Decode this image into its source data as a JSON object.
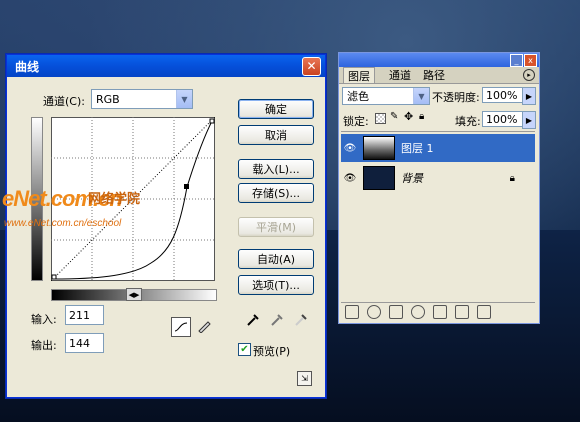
{
  "curves_dialog": {
    "title": "曲线",
    "channel_label": "通道(C):",
    "channel_value": "RGB",
    "ok_label": "确定",
    "cancel_label": "取消",
    "load_label": "载入(L)...",
    "save_label": "存储(S)...",
    "smooth_label": "平滑(M)",
    "auto_label": "自动(A)",
    "options_label": "选项(T)...",
    "input_label": "输入:",
    "input_value": "211",
    "output_label": "输出:",
    "output_value": "144",
    "preview_label": "预览(P)",
    "preview_checked": true
  },
  "layers_panel": {
    "tabs": [
      "图层",
      "通道",
      "路径"
    ],
    "blend_mode": "滤色",
    "opacity_label": "不透明度:",
    "opacity_value": "100%",
    "lock_label": "锁定:",
    "fill_label": "填充:",
    "fill_value": "100%",
    "layers": [
      {
        "name": "图层 1",
        "selected": true
      },
      {
        "name": "背景",
        "selected": false,
        "locked": true
      }
    ]
  },
  "watermark": {
    "logo": "eNet.com.cn",
    "chinese": "网络学院",
    "url": "www.eNet.com.cn/eschool"
  },
  "colors": {
    "titlebar": "#0550da",
    "selected_layer": "#316ac5",
    "dialog_bg": "#ece9d8"
  }
}
